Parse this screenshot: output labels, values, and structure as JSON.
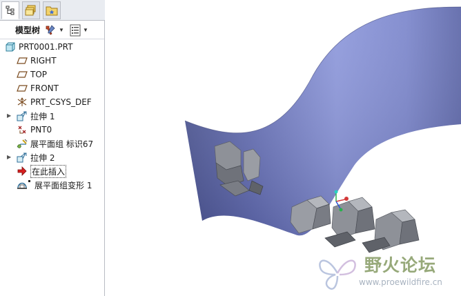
{
  "model_tree": {
    "header_label": "模型树",
    "items": [
      {
        "label": "PRT0001.PRT",
        "icon": "part-icon",
        "expandable": false
      },
      {
        "label": "RIGHT",
        "icon": "datum-plane-icon",
        "expandable": false
      },
      {
        "label": "TOP",
        "icon": "datum-plane-icon",
        "expandable": false
      },
      {
        "label": "FRONT",
        "icon": "datum-plane-icon",
        "expandable": false
      },
      {
        "label": "PRT_CSYS_DEF",
        "icon": "csys-icon",
        "expandable": false
      },
      {
        "label": "拉伸 1",
        "icon": "extrude-icon",
        "expandable": true
      },
      {
        "label": "PNT0",
        "icon": "datum-point-icon",
        "expandable": false
      },
      {
        "label": "展平面组 标识67",
        "icon": "flatten-quilt-icon",
        "expandable": false
      },
      {
        "label": "拉伸 2",
        "icon": "extrude-icon",
        "expandable": true
      },
      {
        "label": "在此插入",
        "icon": "insert-here-arrow-icon",
        "expandable": false
      },
      {
        "label": "展平面组变形 1",
        "icon": "flatten-deform-icon",
        "expandable": false
      }
    ]
  },
  "watermark": {
    "chinese_text": "野火论坛",
    "url_text": "www.proewildfire.cn"
  },
  "colors": {
    "surface": "#8a95d6",
    "surface_dark": "#4d568f",
    "letters": "#8f939a",
    "panel_border": "#b9bcc3"
  }
}
